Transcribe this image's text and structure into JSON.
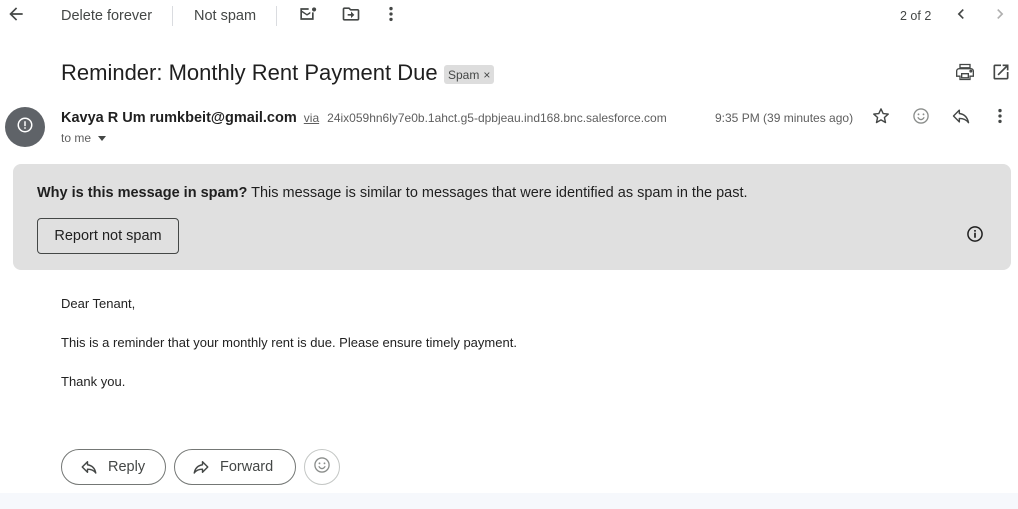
{
  "toolbar": {
    "back_icon": "arrow-left-icon",
    "delete_forever_label": "Delete forever",
    "not_spam_label": "Not spam",
    "mark_unread_icon": "mark-unread-icon",
    "move_to_icon": "move-to-folder-icon",
    "more_icon": "more-vertical-icon",
    "pagination": "2 of 2",
    "prev_icon": "chevron-left-icon",
    "next_icon": "chevron-right-icon"
  },
  "email": {
    "subject": "Reminder: Monthly Rent Payment Due",
    "label_chip": "Spam",
    "label_chip_close": "×",
    "print_icon": "print-icon",
    "open_new_window_icon": "open-in-new-icon",
    "sender_name": "Kavya R Um",
    "sender_email": "rumkbeit@gmail.com",
    "via_label": "via",
    "via_domain": "24ix059hn6ly7e0b.1ahct.g5-dpbjeau.ind168.bnc.salesforce.com",
    "recipient": "to me",
    "timestamp": "9:35 PM (39 minutes ago)",
    "star_icon": "star-icon",
    "emoji_icon": "emoji-react-icon",
    "reply_icon": "reply-icon",
    "more_icon": "more-vertical-icon"
  },
  "spam_banner": {
    "question": "Why is this message in spam?",
    "explanation": " This message is similar to messages that were identified as spam in the past.",
    "report_button": "Report not spam",
    "info_icon": "info-icon"
  },
  "body": {
    "greeting": "Dear Tenant,",
    "message": "This is a reminder that your monthly rent is due. Please ensure timely payment.",
    "closing": "Thank you."
  },
  "actions": {
    "reply_label": "Reply",
    "forward_label": "Forward",
    "emoji_icon": "emoji-react-icon"
  },
  "colors": {
    "banner_bg": "#e0e0e0",
    "avatar_bg": "#5f6368",
    "text_primary": "#1f1f1f",
    "text_secondary": "#5e5e5e"
  }
}
